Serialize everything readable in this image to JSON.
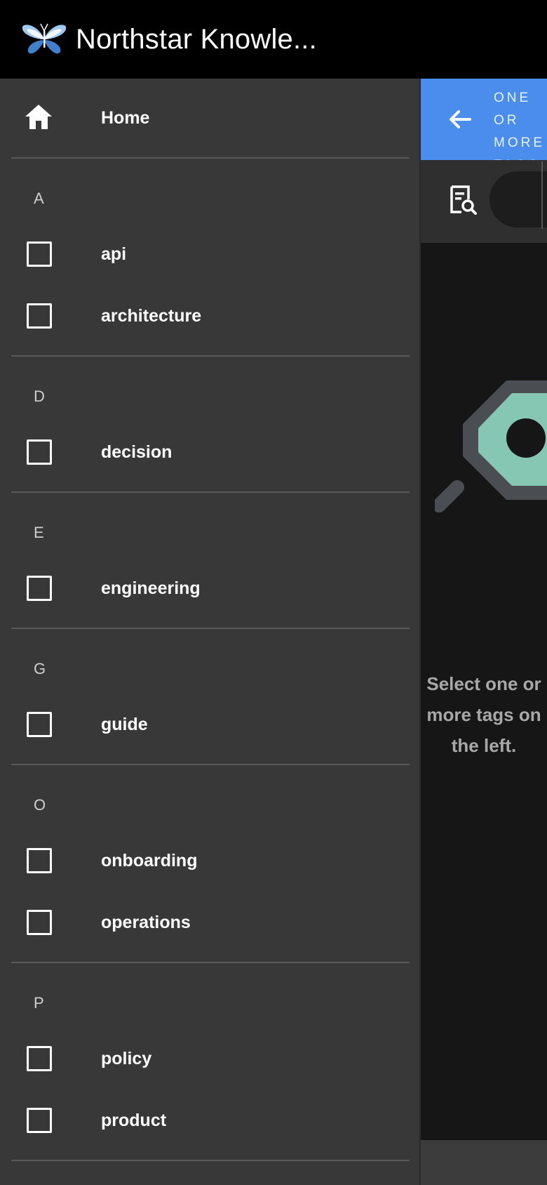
{
  "app": {
    "title": "Northstar Knowle..."
  },
  "drawer": {
    "home_label": "Home",
    "sections": [
      {
        "letter": "A",
        "tags": [
          "api",
          "architecture"
        ]
      },
      {
        "letter": "D",
        "tags": [
          "decision"
        ]
      },
      {
        "letter": "E",
        "tags": [
          "engineering"
        ]
      },
      {
        "letter": "G",
        "tags": [
          "guide"
        ]
      },
      {
        "letter": "O",
        "tags": [
          "onboarding",
          "operations"
        ]
      },
      {
        "letter": "P",
        "tags": [
          "policy",
          "product"
        ]
      }
    ]
  },
  "content": {
    "banner_text": "ONE OR MORE TAGS",
    "empty_message": "Select one or more tags on the left."
  },
  "colors": {
    "banner": "#4a8ded",
    "drawer_bg": "#383838",
    "app_bar": "#000000",
    "illustration_tag": "#85c7b2",
    "illustration_outline": "#4a4d52"
  }
}
